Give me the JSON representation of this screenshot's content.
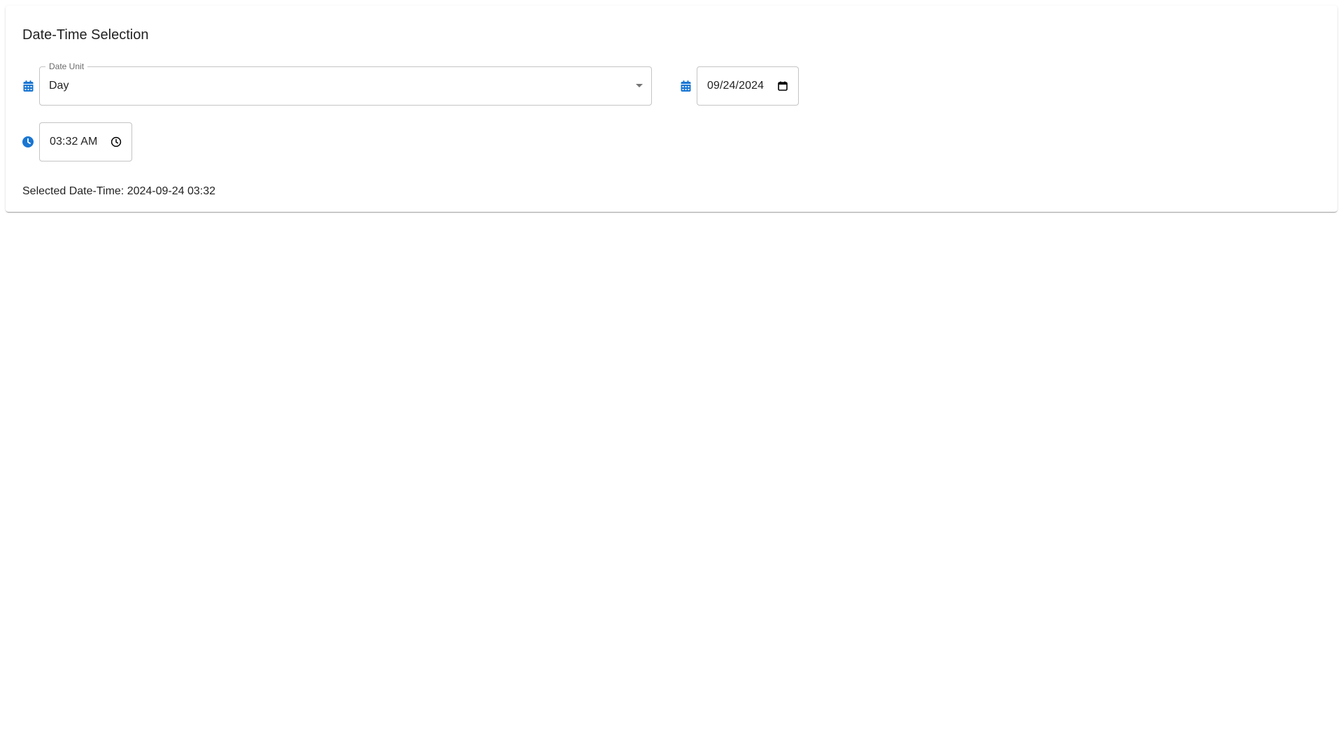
{
  "card": {
    "title": "Date-Time Selection"
  },
  "date_unit": {
    "label": "Date Unit",
    "value": "Day",
    "icon": "calendar-icon"
  },
  "date_input": {
    "value": "09/24/2024",
    "icon": "calendar-icon",
    "trailing_icon": "calendar-picker-icon"
  },
  "time_input": {
    "value": "03:32 AM",
    "icon": "clock-icon",
    "trailing_icon": "clock-picker-icon"
  },
  "selected": {
    "label": "Selected Date-Time: 2024-09-24 03:32"
  },
  "colors": {
    "accent": "#1976d2",
    "border": "#c4c4c4",
    "text": "#212121"
  }
}
